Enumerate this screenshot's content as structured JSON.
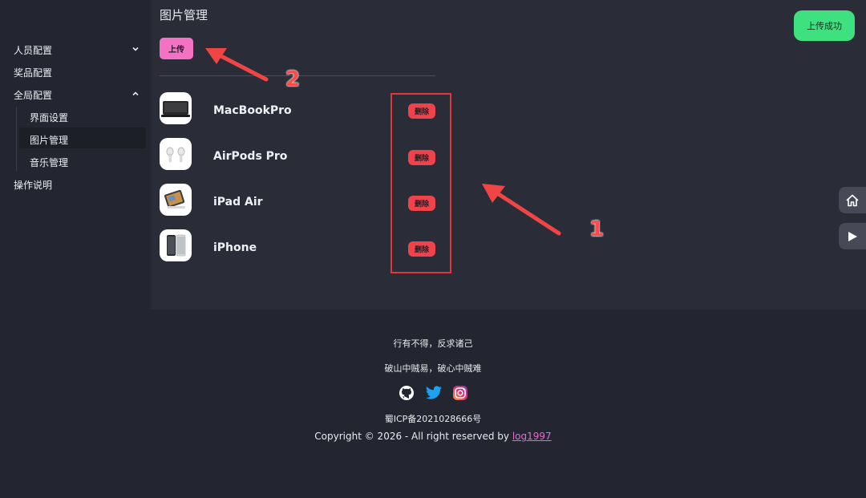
{
  "sidebar": {
    "items": [
      {
        "label": "人员配置",
        "chevron": "down"
      },
      {
        "label": "奖品配置"
      },
      {
        "label": "全局配置",
        "chevron": "up"
      },
      {
        "label": "操作说明"
      }
    ],
    "sub_items": [
      {
        "label": "界面设置"
      },
      {
        "label": "图片管理",
        "active": true
      },
      {
        "label": "音乐管理"
      }
    ]
  },
  "main": {
    "title": "图片管理",
    "upload_label": "上传",
    "rows": [
      {
        "name": "MacBookPro",
        "thumb": "macbook-image",
        "delete_label": "删除"
      },
      {
        "name": "AirPods Pro",
        "thumb": "airpods-image",
        "delete_label": "删除"
      },
      {
        "name": "iPad Air",
        "thumb": "ipad-image",
        "delete_label": "删除"
      },
      {
        "name": "iPhone",
        "thumb": "iphone-image",
        "delete_label": "删除"
      }
    ]
  },
  "toast": {
    "text": "上传成功"
  },
  "annotations": {
    "one": "1",
    "two": "2"
  },
  "side_buttons": [
    "home-icon",
    "play-icon"
  ],
  "footer": {
    "motto1": "行有不得，反求诸己",
    "motto2": "破山中贼易，破心中贼难",
    "socials": [
      "github-icon",
      "twitter-icon",
      "instagram-icon"
    ],
    "icp": "蜀ICP备2021028666号",
    "copyright_prefix": "Copyright © 2026 - All right reserved by ",
    "author": "log1997"
  },
  "colors": {
    "accent_pink": "#f472c4",
    "delete_red": "#f0424b",
    "toast_green": "#3ee07f",
    "annotation_red": "#e0383a"
  }
}
